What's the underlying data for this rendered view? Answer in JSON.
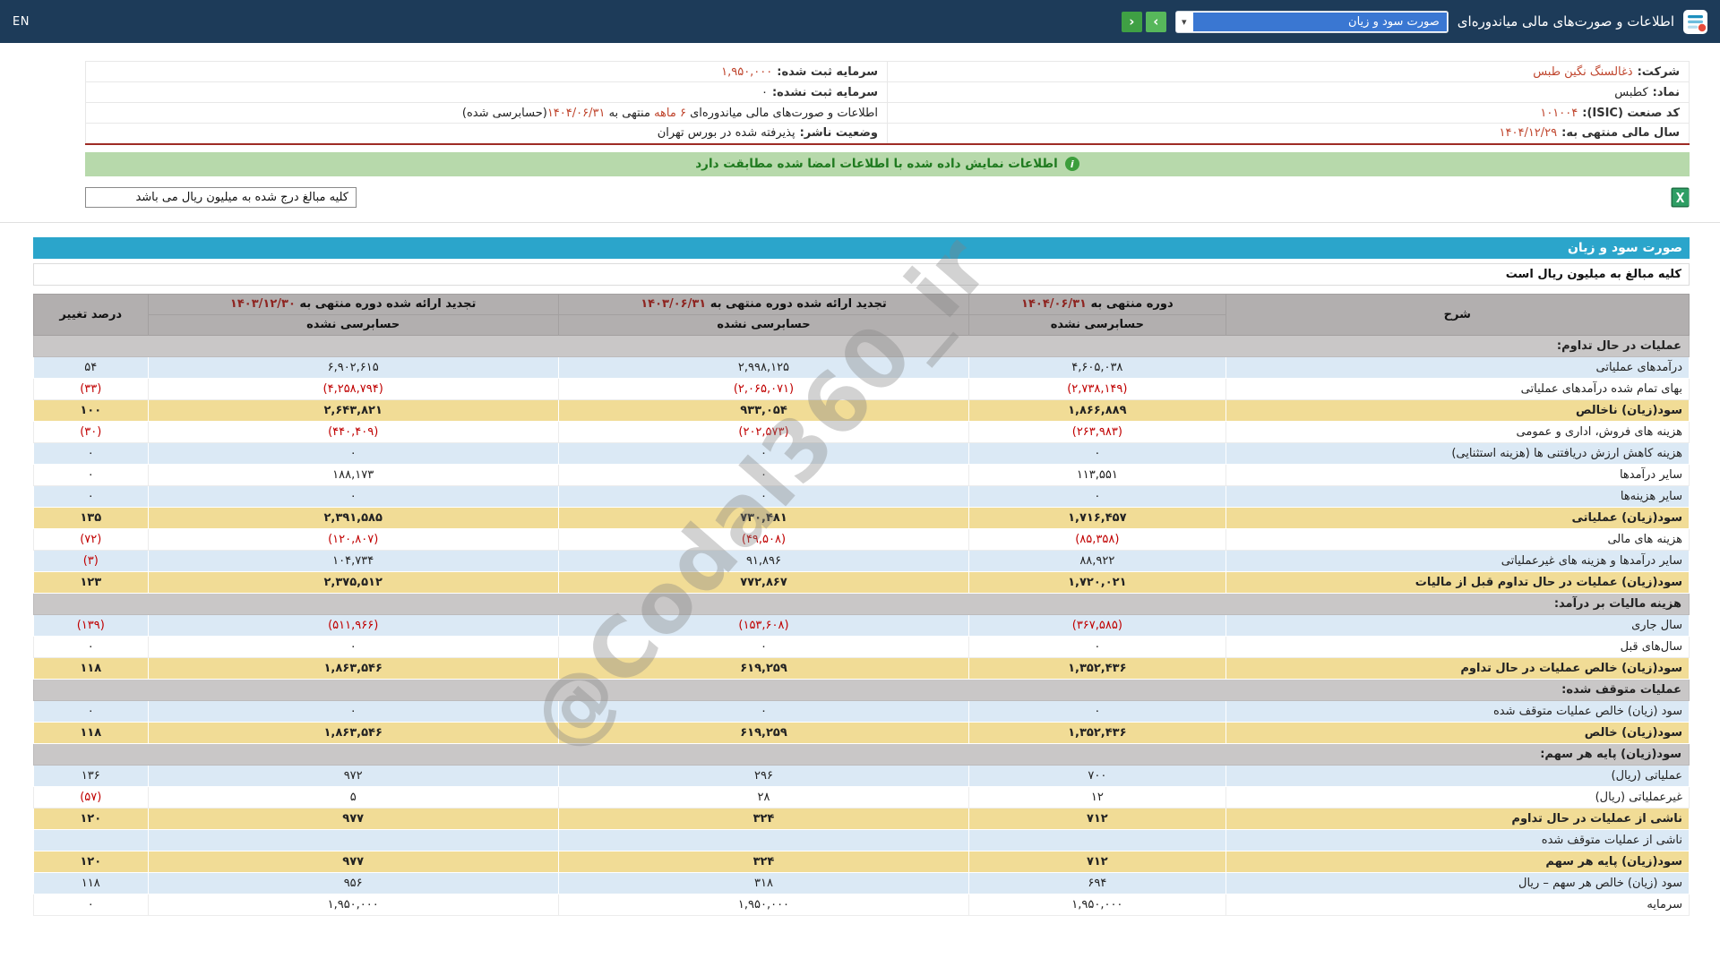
{
  "page": {
    "watermark": "@Codal360_ir"
  },
  "topbar": {
    "en_label": "EN",
    "title": "اطلاعات و صورت‌های مالی میاندوره‌ای",
    "report_select_value": "صورت سود و زیان",
    "icons": {
      "chevron_down": "▾",
      "nav_next": "›",
      "nav_prev": "‹"
    }
  },
  "company_info": {
    "right": [
      {
        "label": "شرکت:",
        "value": "ذغالسنگ نگین طبس"
      },
      {
        "label": "نماد:",
        "value": "کطبس"
      },
      {
        "label": "کد صنعت (ISIC):",
        "value": "۱۰۱۰۰۴"
      },
      {
        "label": "سال مالی منتهی به:",
        "value": "۱۴۰۴/۱۲/۲۹"
      }
    ],
    "left": [
      {
        "label": "سرمایه ثبت شده:",
        "value": "۱,۹۵۰,۰۰۰"
      },
      {
        "label": "سرمایه ثبت نشده:",
        "value": "۰"
      },
      {
        "parts": [
          {
            "text": "اطلاعات و صورت‌های مالی میاندوره‌ای "
          },
          {
            "text": "۶ ماهه"
          },
          {
            "text": " منتهی به "
          },
          {
            "text": "۱۴۰۴/۰۶/۳۱"
          },
          {
            "text": "(حسابرسی شده)"
          }
        ]
      },
      {
        "label": "وضعیت ناشر:",
        "value": "پذیرفته شده در بورس تهران"
      }
    ]
  },
  "notice": {
    "icon_glyph": "i",
    "text": "اطلاعات نمایش داده شده با اطلاعات امضا شده مطابقت دارد"
  },
  "unit_box": {
    "text": "کلیه مبالغ درج شده به میلیون ریال می باشد"
  },
  "statement": {
    "title": "صورت سود و زیان",
    "unit_note": "کلیه مبالغ به میلیون ریال است",
    "headers": {
      "desc": "شرح",
      "change": "درصد تغییر",
      "audit_status": "حسابرسی نشده",
      "period1": {
        "prefix": "دوره منتهی به ",
        "date": "۱۴۰۴/۰۶/۳۱"
      },
      "period2": {
        "prefix": "تجدید ارائه شده دوره منتهی به ",
        "date": "۱۴۰۳/۰۶/۳۱"
      },
      "period3": {
        "prefix": "تجدید ارائه شده دوره منتهی به ",
        "date": "۱۴۰۳/۱۲/۳۰"
      }
    },
    "rows": [
      {
        "type": "section",
        "desc": "عملیات در حال تداوم:"
      },
      {
        "style": "blue",
        "desc": "درآمدهای عملیاتی",
        "v1": "۴,۶۰۵,۰۳۸",
        "v2": "۲,۹۹۸,۱۲۵",
        "v3": "۶,۹۰۲,۶۱۵",
        "chg": "۵۴"
      },
      {
        "style": "white",
        "desc": "بهای تمام شده درآمدهای عملیاتی",
        "v1": "(۲,۷۳۸,۱۴۹)",
        "v2": "(۲,۰۶۵,۰۷۱)",
        "v3": "(۴,۲۵۸,۷۹۴)",
        "chg": "(۳۳)"
      },
      {
        "style": "yellow",
        "desc": "سود(زیان) ناخالص",
        "v1": "۱,۸۶۶,۸۸۹",
        "v2": "۹۳۳,۰۵۴",
        "v3": "۲,۶۴۳,۸۲۱",
        "chg": "۱۰۰"
      },
      {
        "style": "white",
        "desc": "هزینه های فروش، اداری و عمومی",
        "v1": "(۲۶۳,۹۸۳)",
        "v2": "(۲۰۲,۵۷۳)",
        "v3": "(۴۴۰,۴۰۹)",
        "chg": "(۳۰)"
      },
      {
        "style": "blue",
        "desc": "هزینه کاهش ارزش دریافتنی ها (هزینه استثنایی)",
        "v1": "۰",
        "v2": "۰",
        "v3": "۰",
        "chg": "۰"
      },
      {
        "style": "white",
        "desc": "سایر درآمدها",
        "v1": "۱۱۳,۵۵۱",
        "v2": "۰",
        "v3": "۱۸۸,۱۷۳",
        "chg": "۰"
      },
      {
        "style": "blue",
        "desc": "سایر هزینه‌ها",
        "v1": "۰",
        "v2": "۰",
        "v3": "۰",
        "chg": "۰"
      },
      {
        "style": "yellow",
        "desc": "سود(زیان) عملیاتی",
        "v1": "۱,۷۱۶,۴۵۷",
        "v2": "۷۳۰,۴۸۱",
        "v3": "۲,۳۹۱,۵۸۵",
        "chg": "۱۳۵"
      },
      {
        "style": "white",
        "desc": "هزینه های مالی",
        "v1": "(۸۵,۳۵۸)",
        "v2": "(۴۹,۵۰۸)",
        "v3": "(۱۲۰,۸۰۷)",
        "chg": "(۷۲)"
      },
      {
        "style": "blue",
        "desc": "سایر درآمدها و هزینه های غیرعملیاتی",
        "v1": "۸۸,۹۲۲",
        "v2": "۹۱,۸۹۶",
        "v3": "۱۰۴,۷۳۴",
        "chg": "(۳)"
      },
      {
        "style": "yellow",
        "desc": "سود(زیان) عملیات در حال تداوم قبل از مالیات",
        "v1": "۱,۷۲۰,۰۲۱",
        "v2": "۷۷۲,۸۶۷",
        "v3": "۲,۳۷۵,۵۱۲",
        "chg": "۱۲۳"
      },
      {
        "type": "section",
        "desc": "هزینه مالیات بر درآمد:"
      },
      {
        "style": "blue",
        "desc": "سال جاری",
        "v1": "(۳۶۷,۵۸۵)",
        "v2": "(۱۵۳,۶۰۸)",
        "v3": "(۵۱۱,۹۶۶)",
        "chg": "(۱۳۹)"
      },
      {
        "style": "white",
        "desc": "سال‌های قبل",
        "v1": "۰",
        "v2": "۰",
        "v3": "۰",
        "chg": "۰"
      },
      {
        "style": "yellow",
        "desc": "سود(زیان) خالص عملیات در حال تداوم",
        "v1": "۱,۳۵۲,۴۳۶",
        "v2": "۶۱۹,۲۵۹",
        "v3": "۱,۸۶۳,۵۴۶",
        "chg": "۱۱۸"
      },
      {
        "type": "section",
        "desc": "عملیات متوقف شده:"
      },
      {
        "style": "blue",
        "desc": "سود (زیان) خالص عملیات متوقف شده",
        "v1": "۰",
        "v2": "۰",
        "v3": "۰",
        "chg": "۰"
      },
      {
        "style": "yellow",
        "desc": "سود(زیان) خالص",
        "v1": "۱,۳۵۲,۴۳۶",
        "v2": "۶۱۹,۲۵۹",
        "v3": "۱,۸۶۳,۵۴۶",
        "chg": "۱۱۸"
      },
      {
        "type": "section",
        "desc": "سود(زیان) پایه هر سهم:"
      },
      {
        "style": "blue",
        "desc": "عملیاتی (ریال)",
        "v1": "۷۰۰",
        "v2": "۲۹۶",
        "v3": "۹۷۲",
        "chg": "۱۳۶"
      },
      {
        "style": "white",
        "desc": "غیرعملیاتی (ریال)",
        "v1": "۱۲",
        "v2": "۲۸",
        "v3": "۵",
        "chg": "(۵۷)"
      },
      {
        "style": "yellow",
        "desc": "ناشی از عملیات در حال تداوم",
        "v1": "۷۱۲",
        "v2": "۳۲۴",
        "v3": "۹۷۷",
        "chg": "۱۲۰"
      },
      {
        "style": "blue",
        "desc": "ناشی از عملیات متوقف شده",
        "v1": "",
        "v2": "",
        "v3": "",
        "chg": ""
      },
      {
        "style": "yellow",
        "desc": "سود(زیان) پایه هر سهم",
        "v1": "۷۱۲",
        "v2": "۳۲۴",
        "v3": "۹۷۷",
        "chg": "۱۲۰"
      },
      {
        "style": "blue",
        "desc": "سود (زیان) خالص هر سهم – ریال",
        "v1": "۶۹۴",
        "v2": "۳۱۸",
        "v3": "۹۵۶",
        "chg": "۱۱۸"
      },
      {
        "style": "white",
        "desc": "سرمایه",
        "v1": "۱,۹۵۰,۰۰۰",
        "v2": "۱,۹۵۰,۰۰۰",
        "v3": "۱,۹۵۰,۰۰۰",
        "chg": "۰"
      }
    ]
  }
}
